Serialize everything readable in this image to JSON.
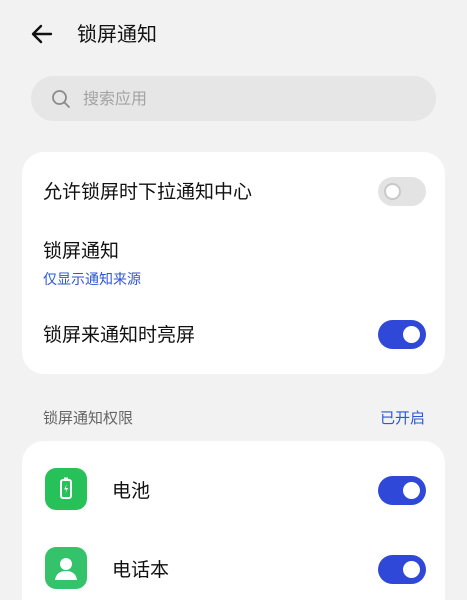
{
  "header": {
    "back_icon": "arrow-left-icon",
    "title": "锁屏通知"
  },
  "search": {
    "icon": "search-icon",
    "placeholder": "搜索应用",
    "value": ""
  },
  "main_settings": [
    {
      "label": "允许锁屏时下拉通知中心",
      "toggle": "off"
    },
    {
      "label": "锁屏通知",
      "sub": "仅显示通知来源"
    },
    {
      "label": "锁屏来通知时亮屏",
      "toggle": "on"
    }
  ],
  "permissions": {
    "section_label": "锁屏通知权限",
    "status": "已开启",
    "apps": [
      {
        "name": "电池",
        "icon": "battery-icon",
        "toggle": "on"
      },
      {
        "name": "电话本",
        "icon": "contacts-icon",
        "toggle": "on"
      }
    ]
  },
  "colors": {
    "accent": "#2f48d8",
    "link": "#2e56d6",
    "background": "#f2f2f2",
    "app_green": "#27c15a"
  }
}
